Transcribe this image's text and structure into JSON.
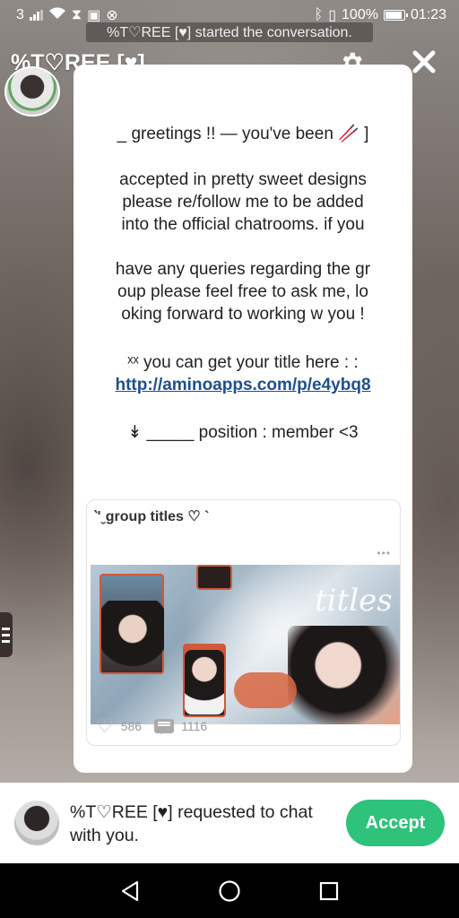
{
  "status_bar": {
    "carrier": "3",
    "battery": "100%",
    "time": "01:23"
  },
  "toast": "%T♡REE [♥] started the conversation.",
  "header": {
    "title": "%T♡REE [♥]",
    "settings_icon": "gear-icon",
    "close_icon": "close-icon"
  },
  "message": {
    "line1": "_  greetings !! — you've been 🥢 ]",
    "para2": [
      "accepted in pretty sweet designs",
      "please re/follow me to be  added",
      "into the official chatrooms. if you"
    ],
    "para3": [
      "have any queries regarding the gr",
      "oup please feel free to ask me, lo",
      "oking forward to working w you !"
    ],
    "title_line": "ˣˣ  you can get your title here  : :",
    "link": "http://aminoapps.com/p/e4ybq8",
    "position_line": "↡   _____   position : member <3"
  },
  "preview": {
    "title": "‵'ˬgroup titles ♡ `",
    "image_text": "titles",
    "likes": "586",
    "comments": "1116"
  },
  "request": {
    "text": "%T♡REE [♥] requested to chat with you.",
    "accept_label": "Accept"
  },
  "colors": {
    "accent": "#2ec27b",
    "link": "#1f4f8f"
  }
}
